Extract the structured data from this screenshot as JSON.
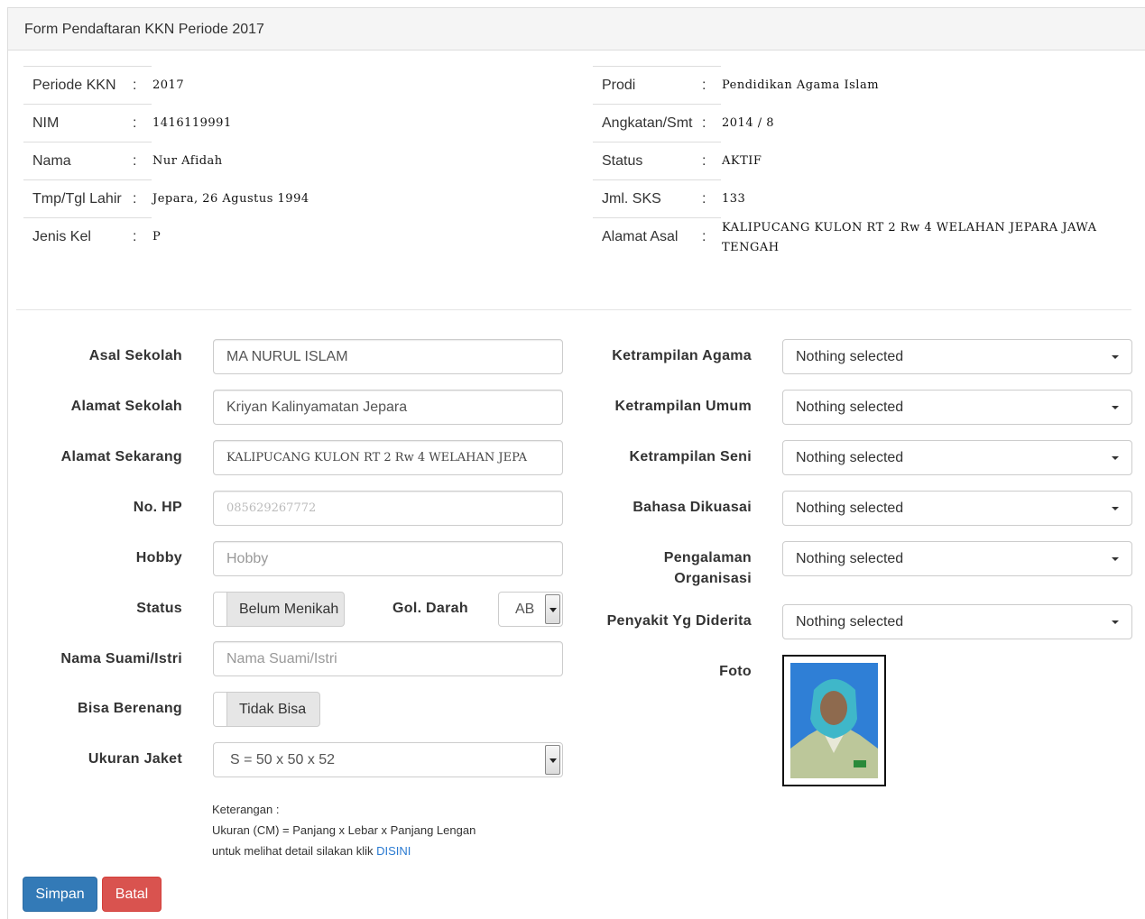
{
  "panel": {
    "title": "Form Pendaftaran KKN Periode 2017"
  },
  "info_left": [
    {
      "label": "Periode KKN",
      "value": "2017"
    },
    {
      "label": "NIM",
      "value": "1416119991"
    },
    {
      "label": "Nama",
      "value": "Nur Afidah"
    },
    {
      "label": "Tmp/Tgl Lahir",
      "value": "Jepara, 26 Agustus 1994"
    },
    {
      "label": "Jenis Kel",
      "value": "P"
    }
  ],
  "info_right": [
    {
      "label": "Prodi",
      "value": "Pendidikan Agama Islam"
    },
    {
      "label": "Angkatan/Smt",
      "value": "2014  / 8"
    },
    {
      "label": "Status",
      "value": "AKTIF"
    },
    {
      "label": "Jml. SKS",
      "value": "133"
    },
    {
      "label": "Alamat Asal",
      "value": "KALIPUCANG KULON RT 2 Rw 4 WELAHAN JEPARA JAWA TENGAH"
    }
  ],
  "colon": ":",
  "form_left": {
    "asal_sekolah": {
      "label": "Asal Sekolah",
      "value": "MA NURUL ISLAM"
    },
    "alamat_sekolah": {
      "label": "Alamat Sekolah",
      "value": "Kriyan Kalinyamatan Jepara"
    },
    "alamat_sekarang": {
      "label": "Alamat Sekarang",
      "value": "KALIPUCANG KULON RT 2 Rw 4 WELAHAN JEPA"
    },
    "no_hp": {
      "label": "No. HP",
      "value": "085629267772"
    },
    "hobby": {
      "label": "Hobby",
      "value": "",
      "placeholder": "Hobby"
    },
    "status": {
      "label": "Status",
      "value": "Belum Menikah"
    },
    "gol_darah": {
      "label": "Gol. Darah",
      "value": "AB"
    },
    "nama_suami": {
      "label": "Nama Suami/Istri",
      "value": "",
      "placeholder": "Nama Suami/Istri"
    },
    "bisa_berenang": {
      "label": "Bisa Berenang",
      "value": "Tidak Bisa"
    },
    "ukuran_jaket": {
      "label": "Ukuran Jaket",
      "value": "S = 50 x 50 x 52"
    }
  },
  "form_right": {
    "ketrampilan_agama": {
      "label": "Ketrampilan Agama",
      "value": "Nothing selected"
    },
    "ketrampilan_umum": {
      "label": "Ketrampilan Umum",
      "value": "Nothing selected"
    },
    "ketrampilan_seni": {
      "label": "Ketrampilan Seni",
      "value": "Nothing selected"
    },
    "bahasa_dikuasai": {
      "label": "Bahasa Dikuasai",
      "value": "Nothing selected"
    },
    "pengalaman_organisasi": {
      "label_line1": "Pengalaman",
      "label_line2": "Organisasi",
      "value": "Nothing selected"
    },
    "penyakit": {
      "label": "Penyakit Yg Diderita",
      "value": "Nothing selected"
    },
    "foto": {
      "label": "Foto"
    }
  },
  "keterangan": {
    "line1": "Keterangan :",
    "line2": "Ukuran (CM) = Panjang x Lebar x Panjang Lengan",
    "line3_prefix": "untuk melihat detail silakan klik ",
    "link": "DISINI"
  },
  "buttons": {
    "save": "Simpan",
    "cancel": "Batal"
  },
  "colors": {
    "primary": "#337ab7",
    "danger": "#d9534f",
    "link": "#2a7ad1"
  }
}
